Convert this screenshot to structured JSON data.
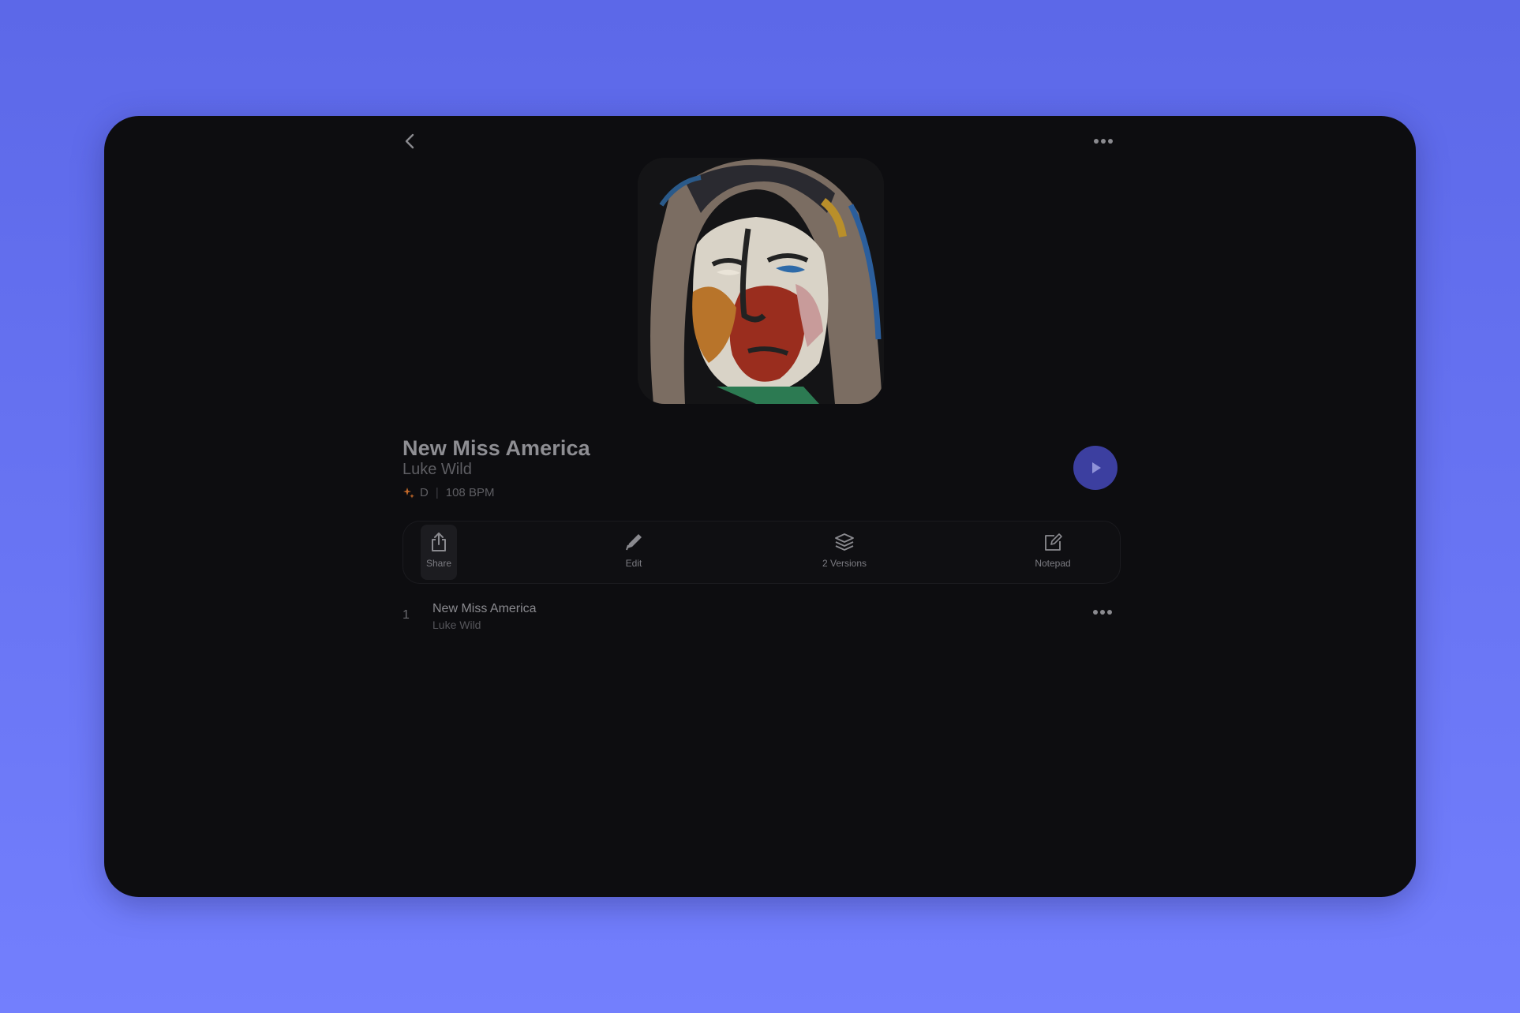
{
  "song": {
    "title": "New Miss America",
    "artist": "Luke Wild",
    "key": "D",
    "separator": "|",
    "tempo": "108 BPM"
  },
  "actions": [
    {
      "label": "Share",
      "icon": "share-icon",
      "selected": true
    },
    {
      "label": "Edit",
      "icon": "pencil-icon"
    },
    {
      "label": "2 Versions",
      "icon": "layers-icon"
    },
    {
      "label": "Notepad",
      "icon": "notepad-icon"
    }
  ],
  "tracks": [
    {
      "number": "1",
      "title": "New Miss America",
      "artist": "Luke Wild"
    }
  ],
  "colors": {
    "background_top": "#5c68e8",
    "background_bottom": "#737ffd",
    "panel": "#0d0d10",
    "play_button": "#3c3fa0",
    "key_accent": "#c56a2a"
  }
}
